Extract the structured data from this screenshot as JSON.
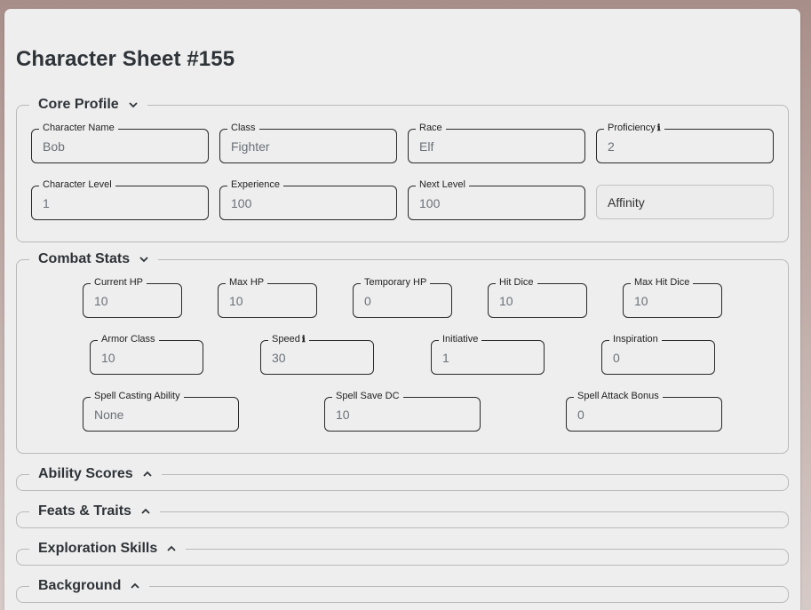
{
  "page": {
    "title": "Character Sheet #155"
  },
  "sections": {
    "core_profile": {
      "title": "Core Profile",
      "fields": {
        "character_name": {
          "label": "Character Name",
          "value": "Bob"
        },
        "class": {
          "label": "Class",
          "value": "Fighter"
        },
        "race": {
          "label": "Race",
          "value": "Elf"
        },
        "proficiency": {
          "label": "Proficiency",
          "value": "2"
        },
        "character_level": {
          "label": "Character Level",
          "value": "1"
        },
        "experience": {
          "label": "Experience",
          "value": "100"
        },
        "next_level": {
          "label": "Next Level",
          "value": "100"
        },
        "affinity": {
          "value": "Affinity"
        }
      }
    },
    "combat_stats": {
      "title": "Combat Stats",
      "fields": {
        "current_hp": {
          "label": "Current HP",
          "value": "10"
        },
        "max_hp": {
          "label": "Max HP",
          "value": "10"
        },
        "temporary_hp": {
          "label": "Temporary HP",
          "value": "0"
        },
        "hit_dice": {
          "label": "Hit Dice",
          "value": "10"
        },
        "max_hit_dice": {
          "label": "Max Hit Dice",
          "value": "10"
        },
        "armor_class": {
          "label": "Armor Class",
          "value": "10"
        },
        "speed": {
          "label": "Speed",
          "value": "30"
        },
        "initiative": {
          "label": "Initiative",
          "value": "1"
        },
        "inspiration": {
          "label": "Inspiration",
          "value": "0"
        },
        "spell_casting_ability": {
          "label": "Spell Casting Ability",
          "value": "None"
        },
        "spell_save_dc": {
          "label": "Spell Save DC",
          "value": "10"
        },
        "spell_attack_bonus": {
          "label": "Spell Attack Bonus",
          "value": "0"
        }
      }
    },
    "ability_scores": {
      "title": "Ability Scores"
    },
    "feats_traits": {
      "title": "Feats & Traits"
    },
    "exploration_skills": {
      "title": "Exploration Skills"
    },
    "background": {
      "title": "Background"
    }
  },
  "icons": {
    "expanded": "chevron-down-icon",
    "collapsed": "chevron-up-icon",
    "info": "info-icon"
  }
}
